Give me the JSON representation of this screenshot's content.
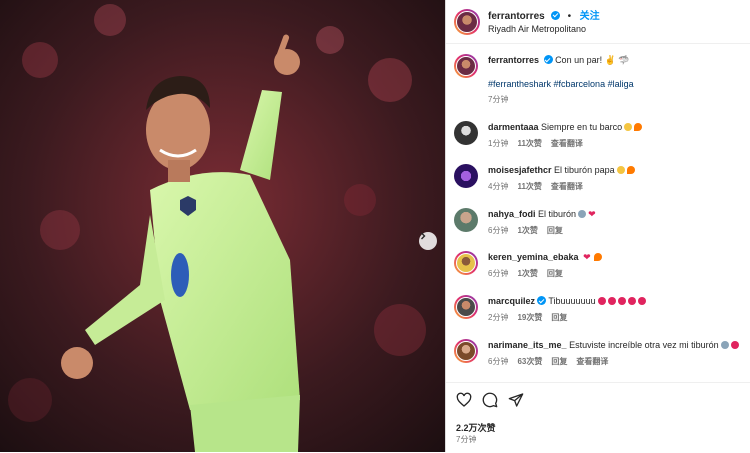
{
  "post": {
    "author": "ferrantorres",
    "follow_label": "关注",
    "separator": "•",
    "location": "Riyadh Air Metropolitano",
    "caption": "Con un par! ✌️ 🦈",
    "hashtags": "#ferrantheshark #fcbarcelona #laliga",
    "caption_time": "7分钟",
    "likes": "2.2万次赞",
    "time_ago": "7分钟"
  },
  "comments": [
    {
      "user": "darmentaaa",
      "text": "Siempre en tu barco",
      "time": "1分钟",
      "likes": "11次赞",
      "action": "查看翻译"
    },
    {
      "user": "moisesjafethcr",
      "text": "El tiburón papa",
      "time": "4分钟",
      "likes": "11次赞",
      "action": "查看翻译"
    },
    {
      "user": "nahya_fodi",
      "text": "El tiburón",
      "time": "6分钟",
      "likes": "1次赞",
      "action": "回复"
    },
    {
      "user": "keren_yemina_ebaka",
      "text": "",
      "time": "6分钟",
      "likes": "1次赞",
      "action": "回复"
    },
    {
      "user": "marcquilez",
      "text": "Tibuuuuuuu",
      "time": "2分钟",
      "likes": "19次赞",
      "action": "回复"
    },
    {
      "user": "narimane_its_me_",
      "text": "Estuviste increíble otra vez mi tiburón",
      "time": "6分钟",
      "likes": "63次赞",
      "action": "回复",
      "action2": "查看翻译"
    }
  ],
  "icons": [
    "carousel-next-icon",
    "heart-icon",
    "comment-icon",
    "share-icon"
  ],
  "colors": {
    "accent": "#0095f6",
    "kit": "#c8ef9a"
  }
}
